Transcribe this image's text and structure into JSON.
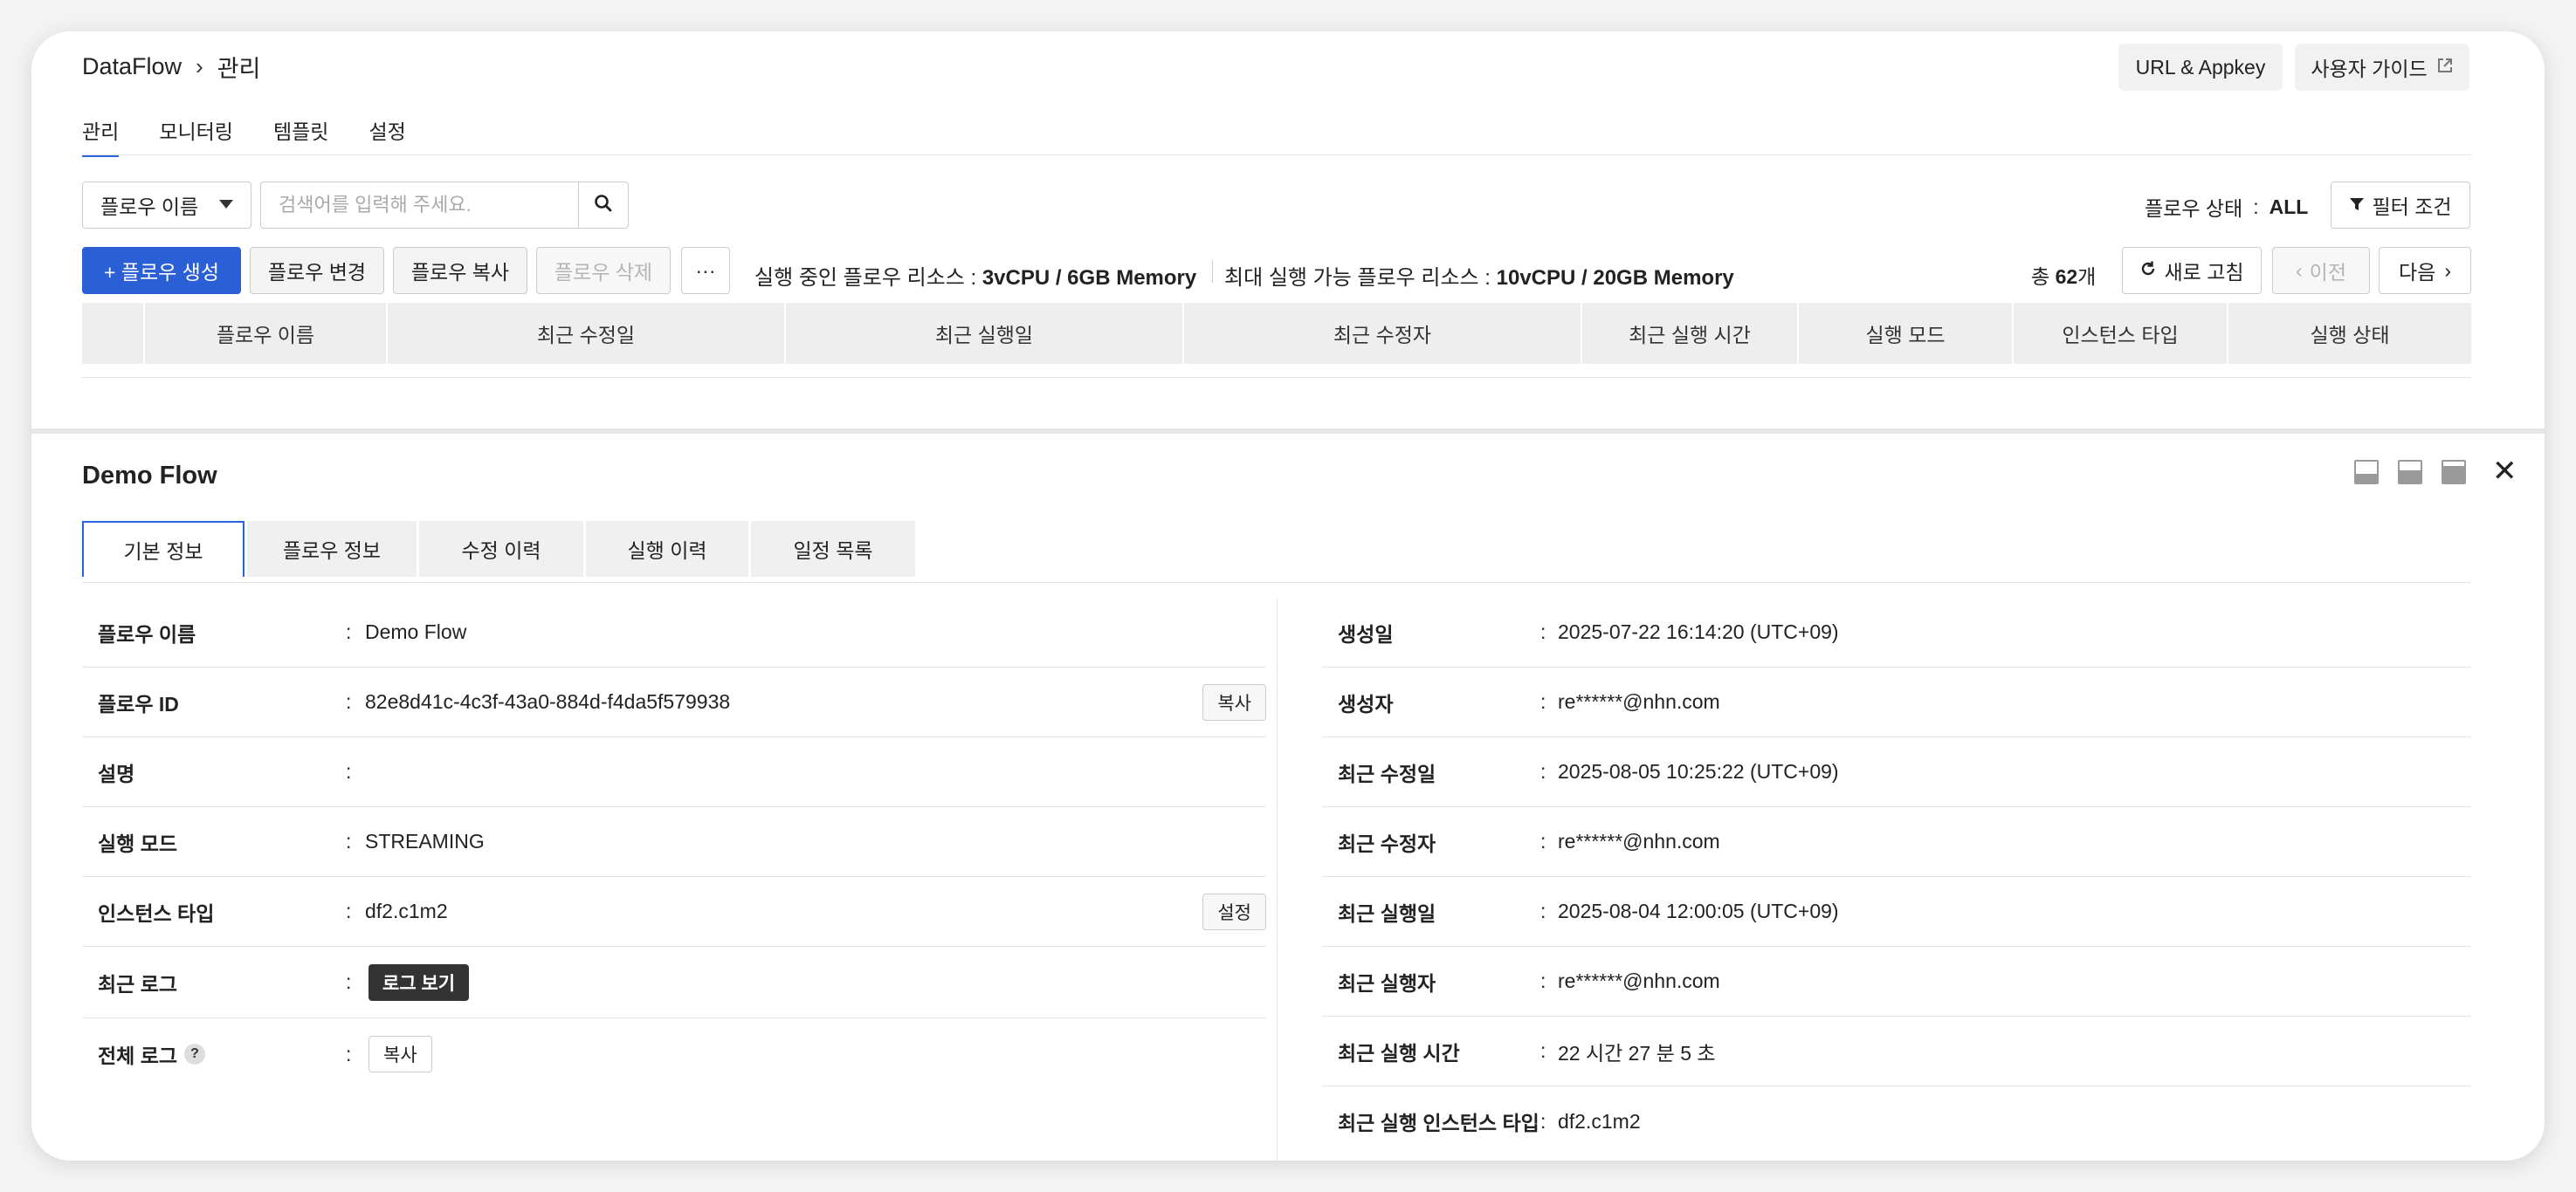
{
  "breadcrumb": {
    "root": "DataFlow",
    "current": "관리"
  },
  "top_buttons": {
    "url_appkey": "URL & Appkey",
    "user_guide": "사용자 가이드"
  },
  "tabs": [
    {
      "label": "관리",
      "active": true
    },
    {
      "label": "모니터링"
    },
    {
      "label": "템플릿"
    },
    {
      "label": "설정"
    }
  ],
  "search": {
    "select_value": "플로우 이름",
    "placeholder": "검색어를 입력해 주세요."
  },
  "flow_status": {
    "label": "플로우 상태",
    "value": "ALL"
  },
  "filter_label": "필터 조건",
  "actions": {
    "create": "+ 플로우 생성",
    "change": "플로우 변경",
    "copy": "플로우 복사",
    "delete": "플로우 삭제",
    "more": "···"
  },
  "resources": {
    "running_label": "실행 중인 플로우 리소스 :",
    "running_value": "3vCPU / 6GB Memory",
    "max_label": "최대 실행 가능 플로우 리소스 :",
    "max_value": "10vCPU / 20GB Memory"
  },
  "pagination": {
    "total_prefix": "총",
    "total_count": "62",
    "total_suffix": "개",
    "refresh": "새로 고침",
    "prev": "이전",
    "next": "다음"
  },
  "table": {
    "headers": [
      "",
      "플로우 이름",
      "최근 수정일",
      "최근 실행일",
      "최근 수정자",
      "최근 실행 시간",
      "실행 모드",
      "인스턴스 타입",
      "실행 상태"
    ]
  },
  "detail": {
    "title": "Demo Flow",
    "tabs": [
      "기본 정보",
      "플로우 정보",
      "수정 이력",
      "실행 이력",
      "일정 목록"
    ],
    "left": [
      {
        "label": "플로우 이름",
        "value": "Demo Flow"
      },
      {
        "label": "플로우 ID",
        "value": "82e8d41c-4c3f-43a0-884d-f4da5f579938",
        "button": "복사"
      },
      {
        "label": "설명",
        "value": ""
      },
      {
        "label": "실행 모드",
        "value": "STREAMING"
      },
      {
        "label": "인스턴스 타입",
        "value": "df2.c1m2",
        "button": "설정"
      },
      {
        "label": "최근 로그",
        "button": "로그 보기"
      },
      {
        "label": "전체 로그",
        "help": "?",
        "button": "복사"
      }
    ],
    "right": [
      {
        "label": "생성일",
        "value": "2025-07-22 16:14:20 (UTC+09)"
      },
      {
        "label": "생성자",
        "value": "re******@nhn.com"
      },
      {
        "label": "최근 수정일",
        "value": "2025-08-05 10:25:22 (UTC+09)"
      },
      {
        "label": "최근 수정자",
        "value": "re******@nhn.com"
      },
      {
        "label": "최근 실행일",
        "value": "2025-08-04 12:00:05 (UTC+09)"
      },
      {
        "label": "최근 실행자",
        "value": "re******@nhn.com"
      },
      {
        "label": "최근 실행 시간",
        "value": "22 시간 27 분 5 초"
      },
      {
        "label": "최근 실행 인스턴스 타입",
        "value": "df2.c1m2"
      }
    ]
  },
  "colors": {
    "primary": "#2b5fd5",
    "tab_active": "#2b63d8",
    "header_bg": "#eeeeee"
  }
}
